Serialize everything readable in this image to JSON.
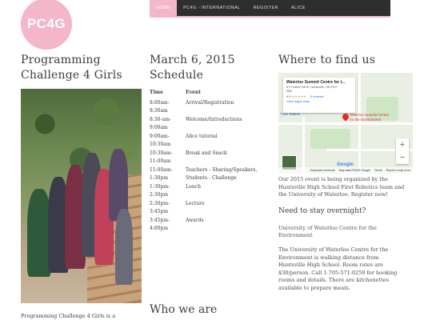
{
  "logo": {
    "text": "PC4G"
  },
  "nav": {
    "items": [
      "HOME",
      "PC4G - INTERNATIONAL",
      "REGISTER",
      "ALICE"
    ],
    "active_index": 0,
    "accent_color": "#f4b6c9"
  },
  "left_column": {
    "title_line1": "Programming",
    "title_line2": "Challenge 4 Girls",
    "caption": "Programming Challenge 4 Girls is a"
  },
  "schedule": {
    "title_line1": "March 6, 2015",
    "title_line2": "Schedule",
    "headers": {
      "time": "Time",
      "event": "Event"
    },
    "rows": [
      {
        "time": [
          "8:00am-",
          "8:30am"
        ],
        "event": [
          "Arrival/Registration"
        ]
      },
      {
        "time": [
          "8:30-am-",
          "9:00am"
        ],
        "event": [
          "Welcome/Introductions"
        ]
      },
      {
        "time": [
          "9:00am-",
          "10:30am"
        ],
        "event": [
          "Alice tutorial"
        ]
      },
      {
        "time": [
          "10:30am-",
          "11:00am"
        ],
        "event": [
          "Break and Snack"
        ]
      },
      {
        "time": [
          "11:00am-",
          "1:30pm"
        ],
        "event": [
          "Teachers - Sharing/Speakers,",
          "Students - Challenge"
        ]
      },
      {
        "time": [
          "1:30pm-",
          "2:30pm"
        ],
        "event": [
          "Lunch"
        ]
      },
      {
        "time": [
          "2:30pm-",
          "3:45pm"
        ],
        "event": [
          "Lecture"
        ]
      },
      {
        "time": [
          "3:45pm-",
          "4:00pm"
        ],
        "event": [
          "Awards"
        ]
      }
    ],
    "who_title": "Who we are"
  },
  "right_column": {
    "title": "Where to find us",
    "map": {
      "place_name": "Waterloo Summit Centre for t...",
      "address_line1": "67 Forbes Hill Dr, Huntsville, ON P1H",
      "address_line2": "0B6",
      "rating": "4.6",
      "stars": "★★★★★",
      "reviews": "5 reviews",
      "larger_map": "View larger map",
      "pin_label_line1": "Waterloo Summit Centre",
      "pin_label_line2": "for the Environment",
      "train_label": "Train Station",
      "zoom_in": "+",
      "zoom_out": "−",
      "google": "Google",
      "footer_shortcuts": "Keyboard shortcuts",
      "footer_data": "Map data ©2025 Google",
      "footer_terms": "Terms",
      "footer_report": "Report a map error"
    },
    "organized_text": "Our 2015 event is being organized by the Huntsville High School First Robotics team and the University of Waterloo. Register now!",
    "overnight_title": "Need to stay overnight?",
    "image_alt": "University of Waterloo Centre for the Environment",
    "accommodation_text": "The University of Waterloo Centre for the Environment is walking distance from Huntsville High School. Room rates are $30/person. Call 1-705-571-0259 for booking rooms and details. There are kitchenettes available to prepare meals."
  }
}
